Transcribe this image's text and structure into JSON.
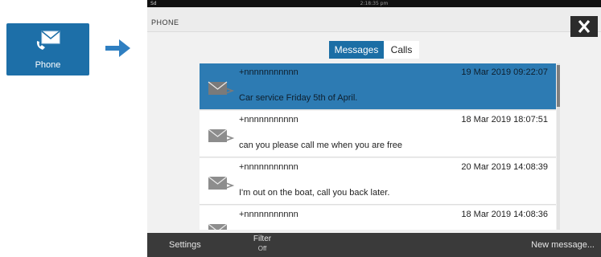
{
  "tile": {
    "label": "Phone",
    "icon": "phone-message-icon",
    "color": "#1d6fa8"
  },
  "arrow": {
    "icon": "right-arrow-icon",
    "color": "#2f7fc1"
  },
  "status": {
    "left": "Sd",
    "time": "2:18:35 pm"
  },
  "window": {
    "title": "PHONE",
    "close_icon": "close-icon"
  },
  "tabs": [
    {
      "label": "Messages",
      "active": true
    },
    {
      "label": "Calls",
      "active": false
    }
  ],
  "messages": [
    {
      "sender": "+nnnnnnnnnnn",
      "date": "19 Mar 2019 09:22:07",
      "body": "Car service Friday 5th of April.",
      "selected": true
    },
    {
      "sender": "+nnnnnnnnnnn",
      "date": "18 Mar 2019 18:07:51",
      "body": "can you please call me when you are free",
      "selected": false
    },
    {
      "sender": "+nnnnnnnnnnn",
      "date": "20 Mar 2019 14:08:39",
      "body": "I'm out on the boat, call you back later.",
      "selected": false
    },
    {
      "sender": "+nnnnnnnnnnn",
      "date": "18 Mar 2019 14:08:36",
      "body": "",
      "selected": false
    }
  ],
  "bottombar": {
    "settings_label": "Settings",
    "filter_label": "Filter",
    "filter_value": "Off",
    "new_message_label": "New message..."
  }
}
